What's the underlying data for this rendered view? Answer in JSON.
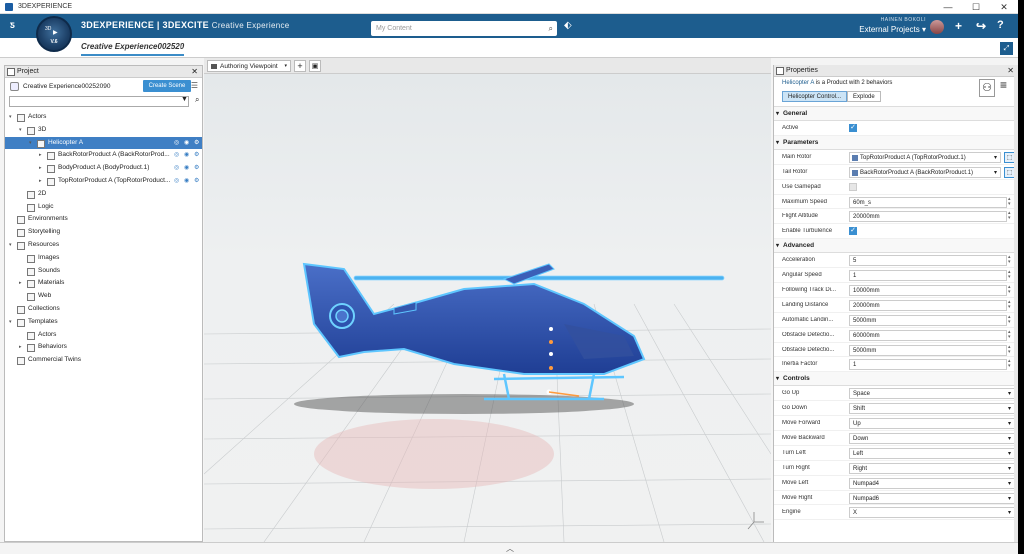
{
  "window": {
    "title": "3DEXPERIENCE"
  },
  "header": {
    "brand_main": "3DEXPERIENCE | 3DEXCITE",
    "brand_sub": "Creative Experience",
    "compass_version": "V.6",
    "search_placeholder": "My Content",
    "user_name": "HAINEN BOKOLI",
    "project": "External Projects"
  },
  "tabs": {
    "active": "Creative Experience002520"
  },
  "project_panel": {
    "title": "Project",
    "project_name": "Creative Experience00252090",
    "create_scene": "Create Scene",
    "tree": [
      {
        "label": "Actors",
        "indent": 0,
        "arrow": "▾"
      },
      {
        "label": "3D",
        "indent": 1,
        "arrow": "▾"
      },
      {
        "label": "Helicopter A",
        "indent": 2,
        "arrow": "▾",
        "selected": true
      },
      {
        "label": "BackRotorProduct A (BackRotorProd...",
        "indent": 3,
        "arrow": "▸"
      },
      {
        "label": "BodyProduct A (BodyProduct.1)",
        "indent": 3,
        "arrow": "▸"
      },
      {
        "label": "TopRotorProduct A (TopRotorProduct...",
        "indent": 3,
        "arrow": "▸"
      },
      {
        "label": "2D",
        "indent": 1,
        "arrow": ""
      },
      {
        "label": "Logic",
        "indent": 1,
        "arrow": ""
      },
      {
        "label": "Environments",
        "indent": 0,
        "arrow": ""
      },
      {
        "label": "Storytelling",
        "indent": 0,
        "arrow": ""
      },
      {
        "label": "Resources",
        "indent": 0,
        "arrow": "▾"
      },
      {
        "label": "Images",
        "indent": 1,
        "arrow": ""
      },
      {
        "label": "Sounds",
        "indent": 1,
        "arrow": ""
      },
      {
        "label": "Materials",
        "indent": 1,
        "arrow": "▸"
      },
      {
        "label": "Web",
        "indent": 1,
        "arrow": ""
      },
      {
        "label": "Collections",
        "indent": 0,
        "arrow": ""
      },
      {
        "label": "Templates",
        "indent": 0,
        "arrow": "▾"
      },
      {
        "label": "Actors",
        "indent": 1,
        "arrow": ""
      },
      {
        "label": "Behaviors",
        "indent": 1,
        "arrow": "▸"
      },
      {
        "label": "Commercial Twins",
        "indent": 0,
        "arrow": ""
      }
    ]
  },
  "viewport_toolbar": {
    "view": "Authoring Viewpoint"
  },
  "properties": {
    "title": "Properties",
    "object": "Helicopter A",
    "object_desc": "is a Product with 2 behaviors",
    "tabs": [
      "Helicopter Control...",
      "Explode"
    ],
    "general": {
      "title": "General",
      "rows": [
        {
          "key": "Active",
          "type": "check",
          "value": true
        }
      ]
    },
    "parameters": {
      "title": "Parameters",
      "rows": [
        {
          "key": "Main Rotor",
          "type": "ref",
          "value": "TopRotorProduct A (TopRotorProduct.1)"
        },
        {
          "key": "Tail Rotor",
          "type": "ref",
          "value": "BackRotorProduct A (BackRotorProduct.1)"
        },
        {
          "key": "Use Gamepad",
          "type": "check",
          "value": false
        },
        {
          "key": "Maximum Speed",
          "type": "num",
          "value": "60m_s"
        },
        {
          "key": "Flight Altitude",
          "type": "num",
          "value": "20000mm"
        },
        {
          "key": "Enable Turbulence",
          "type": "check",
          "value": true
        }
      ]
    },
    "advanced": {
      "title": "Advanced",
      "rows": [
        {
          "key": "Acceleration",
          "type": "num",
          "value": "5"
        },
        {
          "key": "Angular Speed",
          "type": "num",
          "value": "1"
        },
        {
          "key": "Following Track Di...",
          "type": "num",
          "value": "10000mm"
        },
        {
          "key": "Landing Distance",
          "type": "num",
          "value": "20000mm"
        },
        {
          "key": "Automatic Landin...",
          "type": "num",
          "value": "5000mm"
        },
        {
          "key": "Obstacle Detectio...",
          "type": "num",
          "value": "60000mm"
        },
        {
          "key": "Obstacle Detectio...",
          "type": "num",
          "value": "5000mm"
        },
        {
          "key": "Inertia Factor",
          "type": "num",
          "value": "1"
        }
      ]
    },
    "controls": {
      "title": "Controls",
      "rows": [
        {
          "key": "Go Up",
          "type": "select",
          "value": "Space"
        },
        {
          "key": "Go Down",
          "type": "select",
          "value": "Shift"
        },
        {
          "key": "Move Forward",
          "type": "select",
          "value": "Up"
        },
        {
          "key": "Move Backward",
          "type": "select",
          "value": "Down"
        },
        {
          "key": "Turn Left",
          "type": "select",
          "value": "Left"
        },
        {
          "key": "Turn Right",
          "type": "select",
          "value": "Right"
        },
        {
          "key": "Move Left",
          "type": "select",
          "value": "Numpad4"
        },
        {
          "key": "Move Right",
          "type": "select",
          "value": "Numpad6"
        },
        {
          "key": "Engine",
          "type": "select",
          "value": "X"
        }
      ]
    }
  }
}
